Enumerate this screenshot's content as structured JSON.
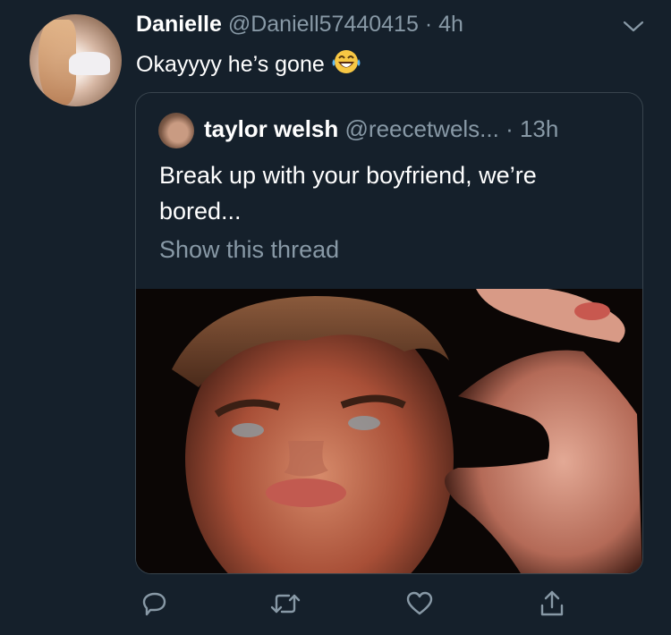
{
  "tweet": {
    "display_name": "Danielle",
    "handle": "@Daniell57440415",
    "separator": "·",
    "time": "4h",
    "text": "Okayyyy he’s gone",
    "emoji": "laughing-tears-emoji"
  },
  "quoted_tweet": {
    "display_name": "taylor welsh",
    "handle": "@reecetwels...",
    "time": "· 13h",
    "text": "Break up with your boyfriend, we’re bored...",
    "show_thread": "Show this thread"
  },
  "actions": {
    "icons": [
      "reply-icon",
      "retweet-icon",
      "like-icon",
      "share-icon"
    ]
  },
  "colors": {
    "background": "#15202b",
    "secondary_text": "#8899a6",
    "border": "#38444d"
  }
}
